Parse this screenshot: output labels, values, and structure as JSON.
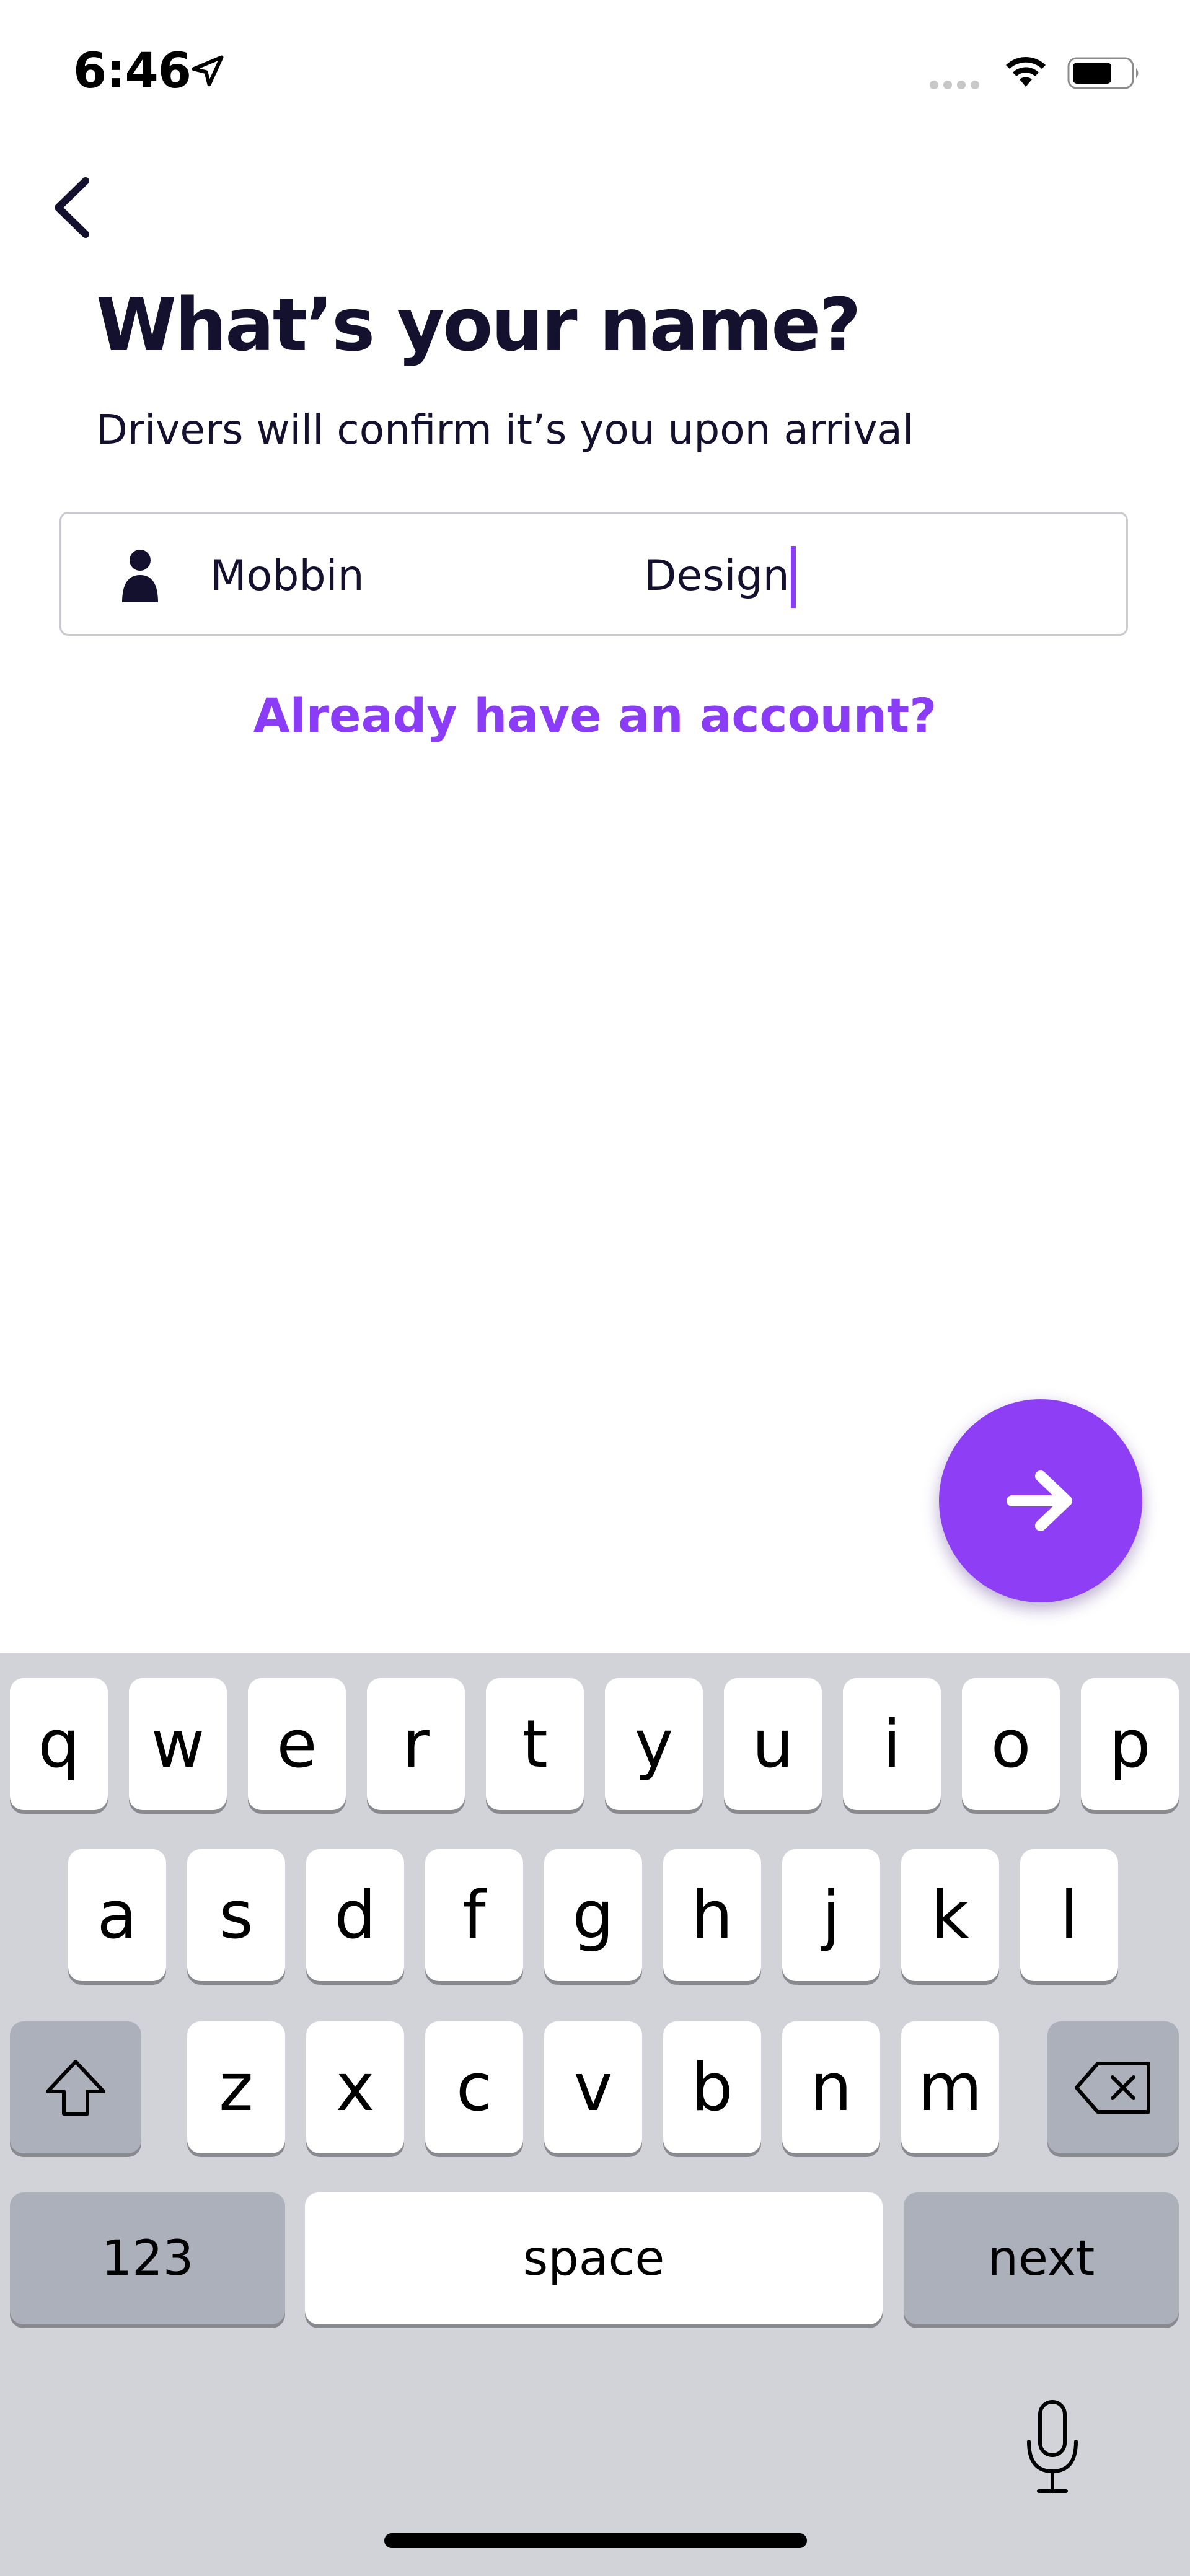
{
  "status_bar": {
    "time": "6:46"
  },
  "header": {
    "title": "What’s your name?",
    "subtitle": "Drivers will confirm it’s you upon arrival"
  },
  "form": {
    "first_name": "Mobbin",
    "last_name": "Design"
  },
  "links": {
    "login": "Already have an account?"
  },
  "keyboard": {
    "row1": [
      "q",
      "w",
      "e",
      "r",
      "t",
      "y",
      "u",
      "i",
      "o",
      "p"
    ],
    "row2": [
      "a",
      "s",
      "d",
      "f",
      "g",
      "h",
      "j",
      "k",
      "l"
    ],
    "row3": [
      "z",
      "x",
      "c",
      "v",
      "b",
      "n",
      "m"
    ],
    "numbers_label": "123",
    "space_label": "space",
    "return_label": "next"
  },
  "colors": {
    "accent": "#8b3cf7",
    "text": "#14112e",
    "keyboard_bg": "#d1d3d9"
  }
}
